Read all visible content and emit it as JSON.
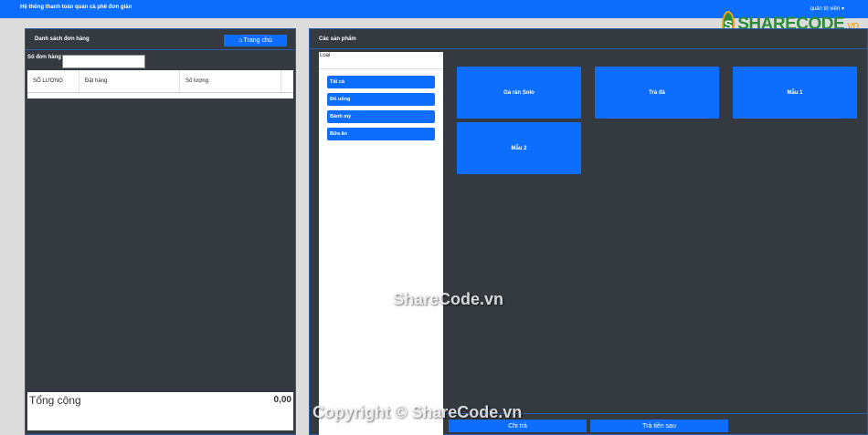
{
  "app": {
    "title": "Hệ thống thanh toán quán cà phê đơn giản",
    "user_menu": "quản trị viên ▾"
  },
  "logo": {
    "badge": "S",
    "main": "SHARECODE",
    "suffix": ".vn"
  },
  "orders": {
    "title": "Danh sách đơn hàng",
    "home_button": "Trang chủ",
    "home_icon": "home-icon",
    "order_number_label": "Số đơn hàng",
    "order_number_value": "",
    "columns": [
      "SỐ LƯỢNG",
      "Đặt hàng",
      "Số lượng"
    ],
    "total_label": "Tổng cộng",
    "total_value": "0,00"
  },
  "products": {
    "title": "Các sản phẩm",
    "category_label": "Loại",
    "categories": [
      "Tất cả",
      "Đồ uống",
      "Bánh mỳ",
      "Bữa ăn"
    ],
    "items": [
      "Gà rán Solo",
      "Trà đá",
      "Mẫu 1",
      "Mẫu 2"
    ],
    "pay_button": "Chi trả",
    "pay_later_button": "Trả tiền sau"
  },
  "watermarks": {
    "center": "ShareCode.vn",
    "bottom": "Copyright © ShareCode.vn"
  },
  "colors": {
    "primary": "#0d6efd",
    "panel": "#343a40",
    "background": "#dcdcdc"
  }
}
